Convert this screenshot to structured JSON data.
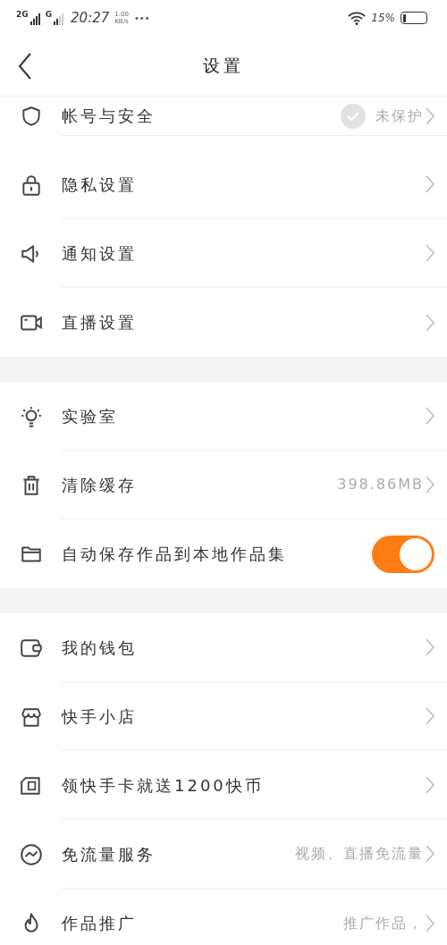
{
  "status_bar": {
    "signal_1": "2G",
    "signal_2": "G",
    "time": "20:27",
    "speed_value": "1.00",
    "speed_unit": "KB/s",
    "more": "•••",
    "battery": "15%"
  },
  "header": {
    "title": "设置"
  },
  "sections": [
    {
      "items": [
        {
          "kind": "link",
          "label": "帐号与安全",
          "value": "未保护",
          "check_badge": true
        },
        {
          "kind": "link",
          "label": "隐私设置"
        },
        {
          "kind": "link",
          "label": "通知设置"
        },
        {
          "kind": "link",
          "label": "直播设置"
        }
      ]
    },
    {
      "items": [
        {
          "kind": "link",
          "label": "实验室"
        },
        {
          "kind": "link",
          "label": "清除缓存",
          "value": "398.86MB"
        },
        {
          "kind": "toggle",
          "label": "自动保存作品到本地作品集",
          "on": true
        }
      ]
    },
    {
      "items": [
        {
          "kind": "link",
          "label": "我的钱包"
        },
        {
          "kind": "link",
          "label": "快手小店"
        },
        {
          "kind": "link",
          "label": "领快手卡就送1200快币"
        },
        {
          "kind": "link",
          "label": "免流量服务",
          "value": "视频、直播免流量"
        },
        {
          "kind": "link",
          "label": "作品推广",
          "value": "推广作品，"
        }
      ]
    }
  ]
}
